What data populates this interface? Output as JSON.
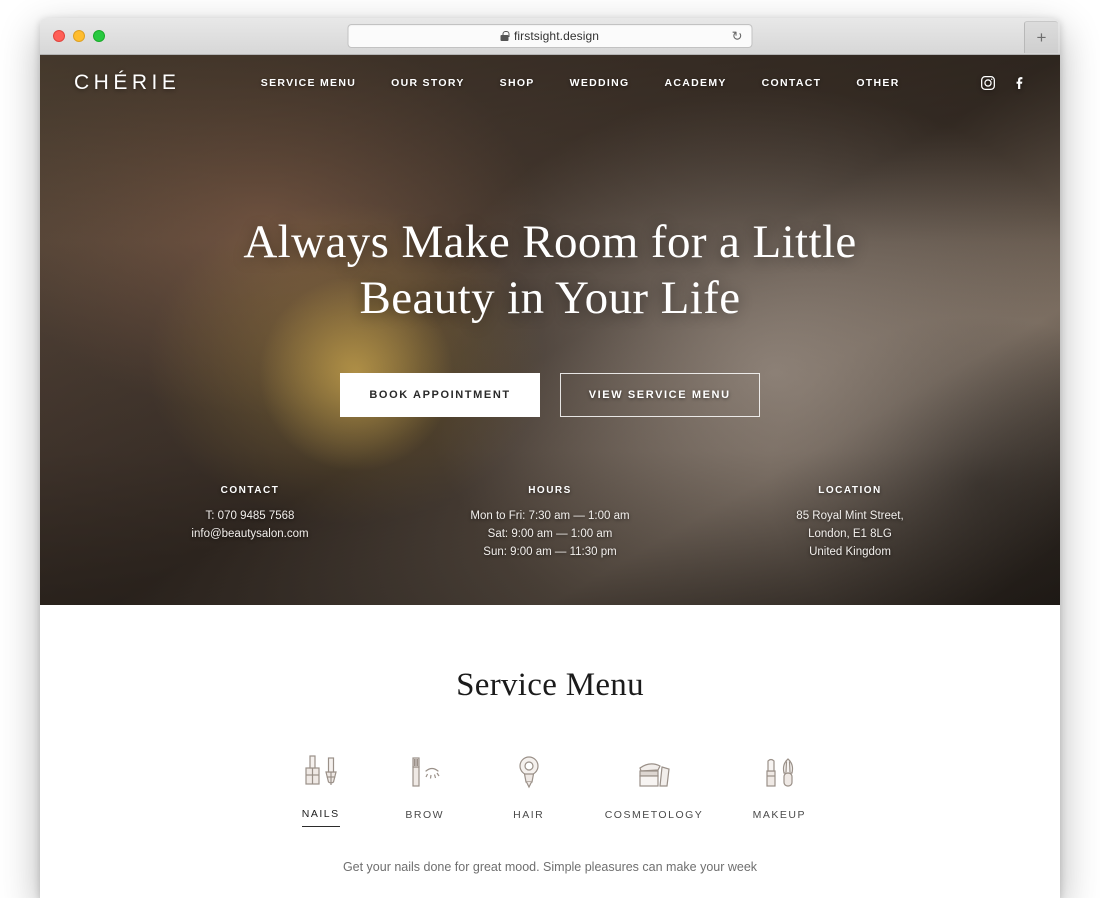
{
  "browser": {
    "url": "firstsight.design",
    "lock_icon": "lock-icon",
    "reload_icon": "reload-icon",
    "new_tab_label": "+",
    "traffic_lights": [
      "close-red",
      "minimize-yellow",
      "maximize-green"
    ]
  },
  "site": {
    "logo": "CHÉRIE",
    "nav": [
      {
        "label": "SERVICE MENU"
      },
      {
        "label": "OUR STORY"
      },
      {
        "label": "SHOP"
      },
      {
        "label": "WEDDING"
      },
      {
        "label": "ACADEMY"
      },
      {
        "label": "CONTACT"
      },
      {
        "label": "OTHER"
      }
    ],
    "socials": [
      {
        "name": "instagram-icon"
      },
      {
        "name": "facebook-icon"
      }
    ]
  },
  "hero": {
    "title_line1": "Always Make Room for a Little",
    "title_line2": "Beauty in Your Life",
    "primary_button": "BOOK APPOINTMENT",
    "secondary_button": "VIEW SERVICE MENU",
    "info": [
      {
        "heading": "CONTACT",
        "lines": [
          "T: 070 9485 7568",
          "info@beautysalon.com"
        ]
      },
      {
        "heading": "HOURS",
        "lines": [
          "Mon to Fri: 7:30 am — 1:00 am",
          "Sat: 9:00 am — 1:00 am",
          "Sun: 9:00 am — 11:30 pm"
        ]
      },
      {
        "heading": "LOCATION",
        "lines": [
          "85 Royal Mint Street,",
          "London, E1 8LG",
          "United Kingdom"
        ]
      }
    ]
  },
  "services": {
    "title": "Service Menu",
    "tabs": [
      {
        "label": "NAILS",
        "icon": "nail-polish-icon",
        "active": true
      },
      {
        "label": "BROW",
        "icon": "brow-brush-icon",
        "active": false
      },
      {
        "label": "HAIR",
        "icon": "hair-dryer-icon",
        "active": false
      },
      {
        "label": "COSMETOLOGY",
        "icon": "cream-jar-icon",
        "active": false
      },
      {
        "label": "MAKEUP",
        "icon": "lipstick-brush-icon",
        "active": false
      }
    ],
    "description": "Get your nails done for great mood. Simple pleasures can make your week"
  },
  "colors": {
    "accent_dark": "#2b2b2b",
    "icon_line": "#9a9088",
    "icon_fill": "#efe9e5",
    "hero_overlay": "#2e2620"
  }
}
